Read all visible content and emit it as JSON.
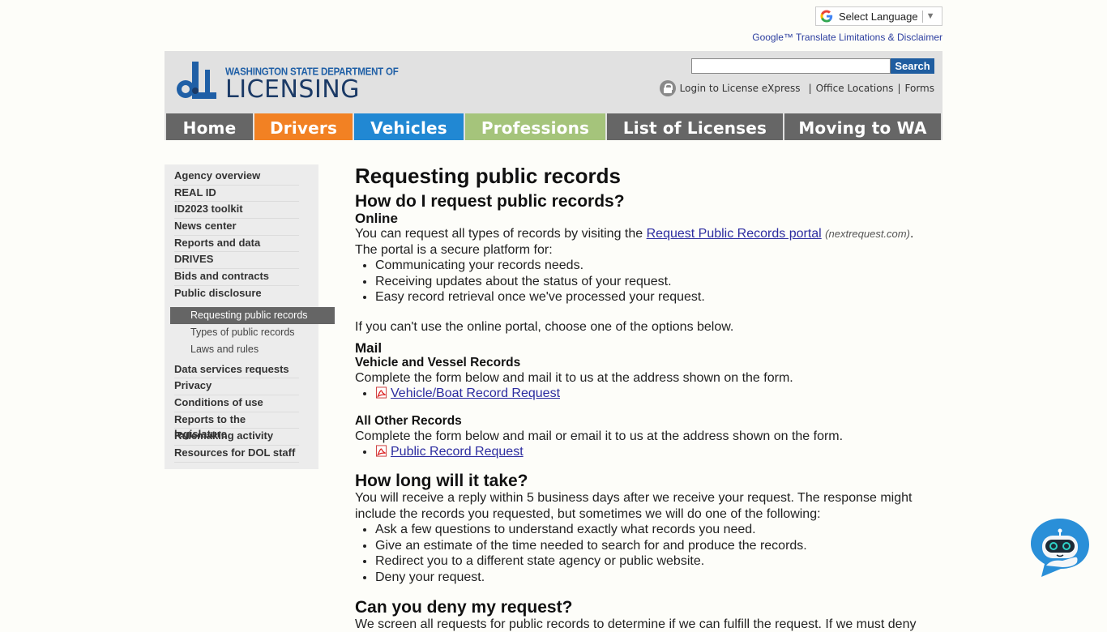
{
  "translate": {
    "label": "Select Language",
    "disclaimer": "Google™ Translate Limitations & Disclaimer"
  },
  "header": {
    "logo_top": "WASHINGTON STATE DEPARTMENT OF",
    "logo_main": "LICENSING",
    "search_placeholder": "",
    "search_value": "",
    "search_button": "Search",
    "util_links": [
      "Login to License eXpress",
      "Office Locations",
      "Forms"
    ],
    "util_sep": "|"
  },
  "nav": [
    {
      "label": "Home",
      "color": "#666666"
    },
    {
      "label": "Drivers",
      "color": "#f28123"
    },
    {
      "label": "Vehicles",
      "color": "#2188d3"
    },
    {
      "label": "Professions",
      "color": "#a5c47b"
    },
    {
      "label": "List of Licenses",
      "color": "#666666"
    },
    {
      "label": "Moving to WA",
      "color": "#666666"
    }
  ],
  "sidebar": {
    "items_top": [
      "Agency overview",
      "REAL ID",
      "ID2023 toolkit",
      "News center",
      "Reports and data",
      "DRIVES",
      "Bids and contracts",
      "Public disclosure"
    ],
    "active": "Requesting public records",
    "subs": [
      "Types of public records",
      "Laws and rules"
    ],
    "items_bottom": [
      "Data services requests",
      "Privacy",
      "Conditions of use",
      "Reports to the legislature",
      "Rulemaking activity",
      "Resources for DOL staff"
    ]
  },
  "content": {
    "title": "Requesting public records",
    "h_how": "How do I request public records?",
    "h_online": "Online",
    "online_text_1": "You can request all types of records by visiting the ",
    "portal_link": "Request Public Records portal",
    "portal_note": "(nextrequest.com)",
    "online_text_2": ".",
    "portal_intro": "The portal is a secure platform for:",
    "portal_bullets": [
      "Communicating your records needs.",
      "Receiving updates about the status of your request.",
      "Easy record retrieval once we've processed your request."
    ],
    "fallback": "If you can't use the online portal, choose one of the options below.",
    "h_mail": "Mail",
    "h_vehicle": "Vehicle and Vessel Records",
    "vehicle_text": "Complete the form below and mail it to us at the address shown on the form.",
    "vehicle_link": "Vehicle/Boat Record Request",
    "h_other": "All Other Records",
    "other_text": "Complete the form below and mail or email it to us at the address shown on the form.",
    "other_link": "Public Record Request",
    "h_long": "How long will it take?",
    "long_text": "You will receive a reply within 5 business days after we receive your request. The response might include the records you requested, but sometimes we will do one of the following:",
    "long_bullets": [
      "Ask a few questions to understand exactly what records you need.",
      "Give an estimate of the time needed to search for and produce the records.",
      "Redirect you to a different state agency or public website.",
      "Deny your request."
    ],
    "h_deny": "Can you deny my request?",
    "deny_text": "We screen all requests for public records to determine if we can fulfill the request. If we must deny"
  }
}
